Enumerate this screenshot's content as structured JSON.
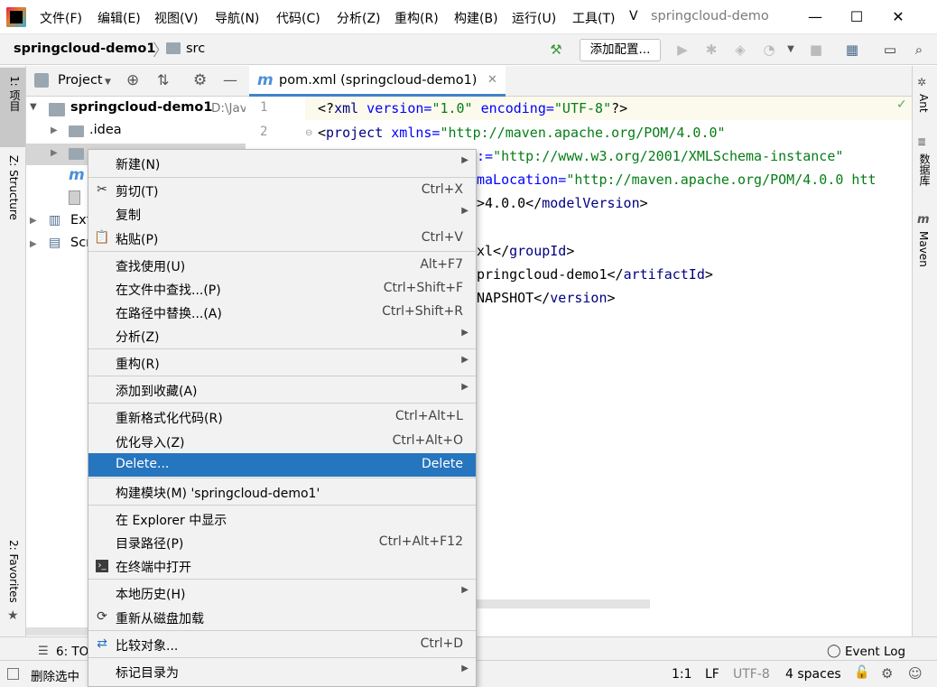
{
  "titlebar": {
    "menu": [
      {
        "label": "文件(F)"
      },
      {
        "label": "编辑(E)"
      },
      {
        "label": "视图(V)"
      },
      {
        "label": "导航(N)"
      },
      {
        "label": "代码(C)"
      },
      {
        "label": "分析(Z)"
      },
      {
        "label": "重构(R)"
      },
      {
        "label": "构建(B)"
      },
      {
        "label": "运行(U)"
      },
      {
        "label": "工具(T)"
      },
      {
        "label": "V"
      }
    ],
    "window_title": "springcloud-demo",
    "minimize": "—",
    "maximize": "☐",
    "close": "✕"
  },
  "navbar": {
    "project": "springcloud-demo1",
    "folder": "src",
    "add_config_label": "添加配置..."
  },
  "left_strip": {
    "project_tab": "1: 项目",
    "structure_tab": "Z: Structure",
    "favorites_tab": "2: Favorites"
  },
  "right_strip": {
    "ant_tab": "Ant",
    "database_tab": "数据库",
    "maven_tab": "Maven"
  },
  "project_panel": {
    "header_label": "Project",
    "tree": {
      "root_label": "springcloud-demo1",
      "root_path": "D:\\Jav",
      "idea_label": ".idea",
      "ext_label": "Ext",
      "scr_label": "Scr"
    }
  },
  "editor": {
    "tab_label": "pom.xml (springcloud-demo1)",
    "line_numbers": [
      "1",
      "2"
    ],
    "lines": [
      [
        "<?",
        "xml",
        " version=",
        "\"1.0\"",
        " encoding=",
        "\"UTF-8\"",
        "?>"
      ],
      [
        "<",
        "project",
        " xmlns=",
        "\"http://maven.apache.org/POM/4.0.0\""
      ],
      [
        ":=",
        "\"http://www.w3.org/2001/XMLSchema-instance\""
      ],
      [
        "maLocation=",
        "\"http://maven.apache.org/POM/4.0.0 htt"
      ],
      [
        ">4.0.0</",
        "modelVersion",
        ">"
      ],
      [
        "xl</",
        "groupId",
        ">"
      ],
      [
        "pringcloud-demo1</",
        "artifactId",
        ">"
      ],
      [
        "NAPSHOT</",
        "version",
        ">"
      ]
    ]
  },
  "context_menu": {
    "items": [
      {
        "label": "新建(N)",
        "shortcut": "",
        "submenu": true
      },
      {
        "label": "剪切(T)",
        "shortcut": "Ctrl+X",
        "icon": "scissors-icon"
      },
      {
        "label": "复制",
        "shortcut": "",
        "submenu": true
      },
      {
        "label": "粘贴(P)",
        "shortcut": "Ctrl+V",
        "icon": "clipboard-icon"
      },
      {
        "label": "查找使用(U)",
        "shortcut": "Alt+F7"
      },
      {
        "label": "在文件中查找...(P)",
        "shortcut": "Ctrl+Shift+F"
      },
      {
        "label": "在路径中替换...(A)",
        "shortcut": "Ctrl+Shift+R"
      },
      {
        "label": "分析(Z)",
        "shortcut": "",
        "submenu": true
      },
      {
        "label": "重构(R)",
        "shortcut": "",
        "submenu": true
      },
      {
        "label": "添加到收藏(A)",
        "shortcut": "",
        "submenu": true
      },
      {
        "label": "重新格式化代码(R)",
        "shortcut": "Ctrl+Alt+L"
      },
      {
        "label": "优化导入(Z)",
        "shortcut": "Ctrl+Alt+O"
      },
      {
        "label": "Delete...",
        "shortcut": "Delete",
        "selected": true
      },
      {
        "label": "构建模块(M) 'springcloud-demo1'",
        "shortcut": ""
      },
      {
        "label": "在 Explorer 中显示",
        "shortcut": ""
      },
      {
        "label": "目录路径(P)",
        "shortcut": "Ctrl+Alt+F12"
      },
      {
        "label": "在终端中打开",
        "shortcut": "",
        "icon": "terminal-icon"
      },
      {
        "label": "本地历史(H)",
        "shortcut": "",
        "submenu": true
      },
      {
        "label": "重新从磁盘加载",
        "shortcut": "",
        "icon": "reload-icon"
      },
      {
        "label": "比较对象...",
        "shortcut": "Ctrl+D",
        "icon": "compare-icon"
      },
      {
        "label": "标记目录为",
        "shortcut": "",
        "submenu": true
      }
    ]
  },
  "statusbar": {
    "todo_label": "6: TO",
    "event_log_label": "Event Log",
    "message": "删除选中",
    "position": "1:1",
    "line_separator": "LF",
    "encoding": "UTF-8",
    "indent": "4 spaces"
  },
  "colors": {
    "selection": "#2675bf",
    "accent_tab": "#4083c9",
    "check": "#59a869"
  }
}
